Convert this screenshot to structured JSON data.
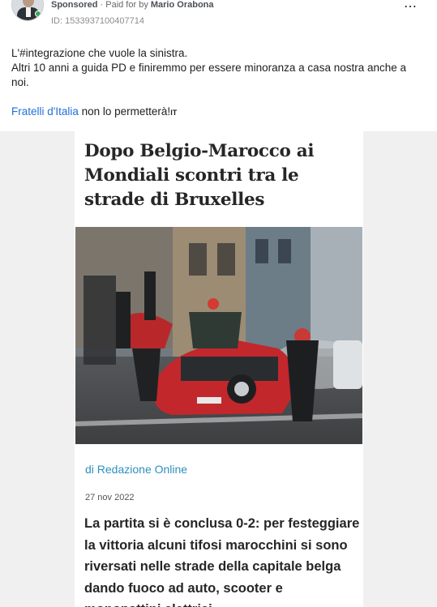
{
  "ad": {
    "sponsored_label": "Sponsored",
    "separator": " · ",
    "paid_for_label": "Paid for by ",
    "advertiser": "Mario Orabona",
    "ad_id": "ID: 1533937100407714",
    "more_icon": "⋯"
  },
  "post": {
    "line1": "L'#integrazione che vuole la sinistra.",
    "line2": "Altri 10 anni a guida PD e finiremmo per essere minoranza a casa nostra anche a noi.",
    "party_link": "Fratelli d'Italia",
    "line3_rest": " non lo permetterà!",
    "flag_emoji": "IT"
  },
  "article": {
    "headline": "Dopo Belgio-Marocco ai Mondiali scontri tra le strade di Bruxelles",
    "byline": "di Redazione Online",
    "date": "27 nov 2022",
    "lead": "La partita si è conclusa 0-2: per festeggiare la vittoria alcuni tifosi marocchini si sono riversati nelle strade della capitale belga dando fuoco ad auto, scooter e monopattini elettrici"
  },
  "colors": {
    "link": "#216fdb",
    "byline": "#2e8fbf",
    "creative_bg": "#f0f0f0"
  }
}
